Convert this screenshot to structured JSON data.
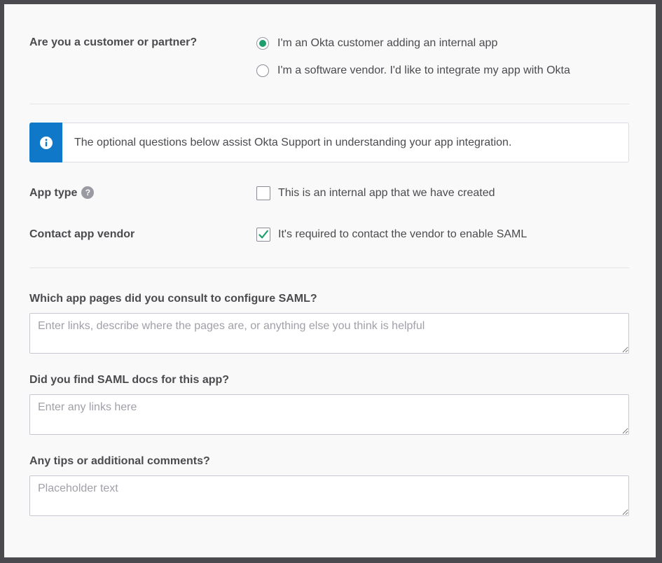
{
  "customer_partner": {
    "label": "Are you a customer or partner?",
    "options": [
      {
        "label": "I'm an Okta customer adding an internal app",
        "checked": true
      },
      {
        "label": "I'm a software vendor. I'd like to integrate my app with Okta",
        "checked": false
      }
    ]
  },
  "info_callout": {
    "icon": "info-icon",
    "text": "The optional questions below assist Okta Support in understanding your app integration."
  },
  "app_type": {
    "label": "App type",
    "help_icon": "?",
    "checkbox_label": "This is an internal app that we have created",
    "checked": false
  },
  "contact_vendor": {
    "label": "Contact app vendor",
    "checkbox_label": "It's required to contact the vendor to enable SAML",
    "checked": true
  },
  "questions": [
    {
      "label": "Which app pages did you consult to configure SAML?",
      "placeholder": "Enter links, describe where the pages are, or anything else you think is helpful",
      "value": ""
    },
    {
      "label": "Did you find SAML docs for this app?",
      "placeholder": "Enter any links here",
      "value": ""
    },
    {
      "label": "Any tips or additional comments?",
      "placeholder": "Placeholder text",
      "value": ""
    }
  ],
  "colors": {
    "accent_green": "#1f9f6e",
    "info_blue": "#0f78c8",
    "text": "#4b4b4f"
  }
}
